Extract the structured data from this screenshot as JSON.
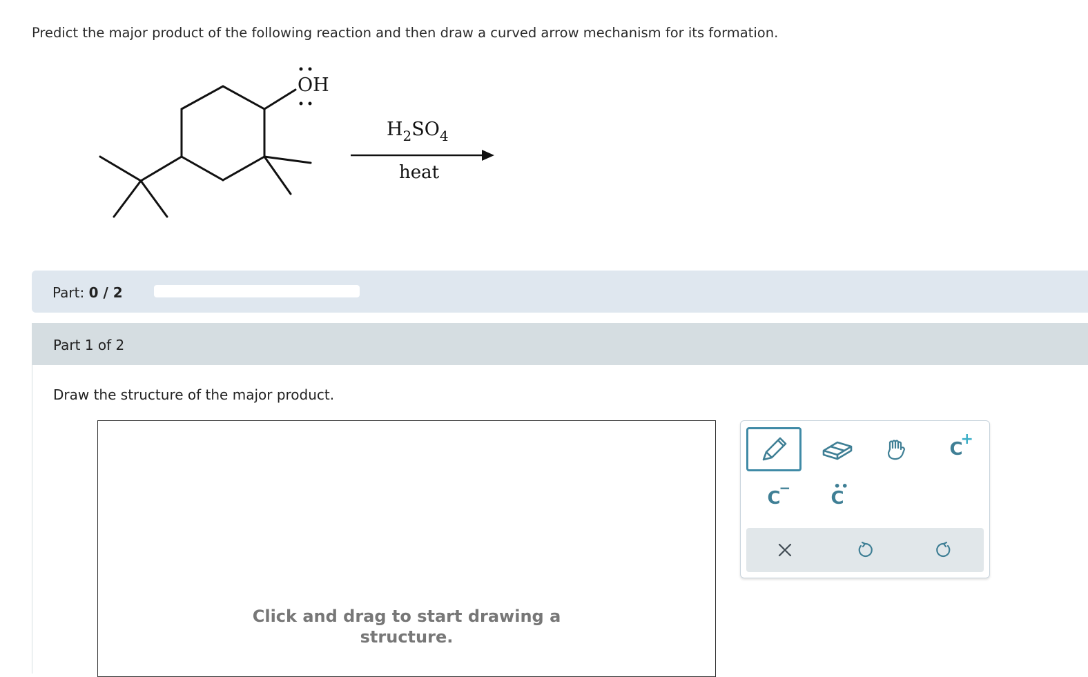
{
  "question": {
    "text": "Predict the major product of the following reaction and then draw a curved arrow mechanism for its formation."
  },
  "reaction": {
    "oh_label": "OH",
    "reagent_h": "H",
    "reagent_sub2": "2",
    "reagent_so": "SO",
    "reagent_sub4": "4",
    "condition": "heat"
  },
  "progress": {
    "prefix": "Part: ",
    "value": "0 / 2",
    "fraction": 0
  },
  "part_header": {
    "label": "Part 1 of 2"
  },
  "part1": {
    "instruction": "Draw the structure of the major product.",
    "canvas_hint_line1": "Click and drag to start drawing a",
    "canvas_hint_line2": "structure."
  },
  "toolbox": {
    "tools": [
      "pencil-icon",
      "eraser-icon",
      "hand-icon",
      "add-positive-charge",
      "add-negative-charge",
      "add-lone-pair"
    ],
    "carbon_label": "C",
    "plus_sign": "+",
    "minus_sign": "−",
    "actions": [
      "clear-icon",
      "undo-icon",
      "redo-icon"
    ],
    "accent_color": "#3f8aa6"
  }
}
